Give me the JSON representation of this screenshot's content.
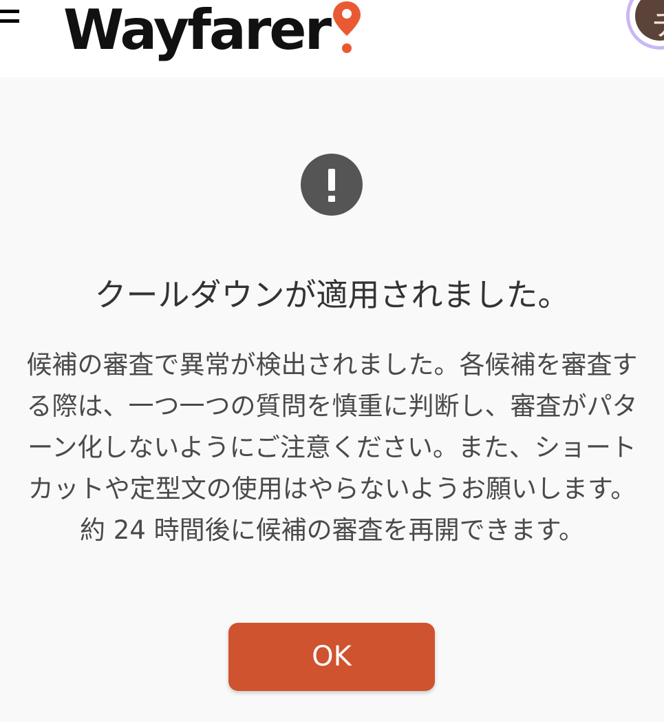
{
  "header": {
    "logo_text": "Wayfarer",
    "menu_icon": "hamburger-menu-icon",
    "pin_icon": "map-pin-icon",
    "avatar_initial": "チ"
  },
  "dialog": {
    "icon": "exclamation-circle-icon",
    "title": "クールダウンが適用されました。",
    "message_lines": [
      "候補の審査で異常が検出されました。各候補を審査す",
      "る際は、一つ一つの質問を慎重に判断し、審査がパタ",
      "ーン化しないようにご注意ください。また、ショート",
      "カットや定型文の使用はやらないようお願いします。",
      "約 24 時間後に候補の審査を再開できます。"
    ],
    "ok_label": "OK"
  },
  "colors": {
    "accent": "#cf532f",
    "pin": "#ea5a32",
    "icon_bg": "#555555",
    "avatar_ring": "#c9b8f4",
    "avatar_bg": "#5b4339"
  }
}
